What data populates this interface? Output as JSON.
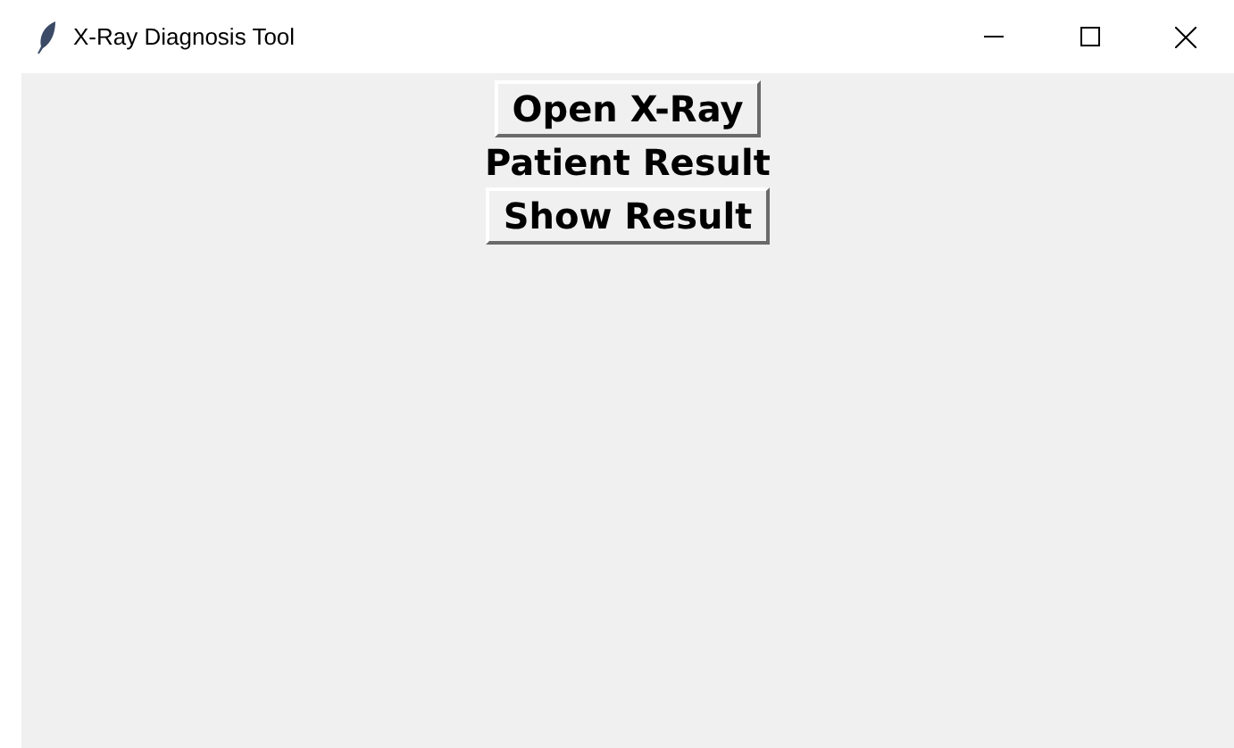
{
  "window": {
    "title": "X-Ray Diagnosis Tool"
  },
  "content": [
    {
      "kind": "button",
      "label": "Open X-Ray"
    },
    {
      "kind": "label",
      "label": "Patient Result"
    },
    {
      "kind": "button",
      "label": "Show Result"
    }
  ]
}
